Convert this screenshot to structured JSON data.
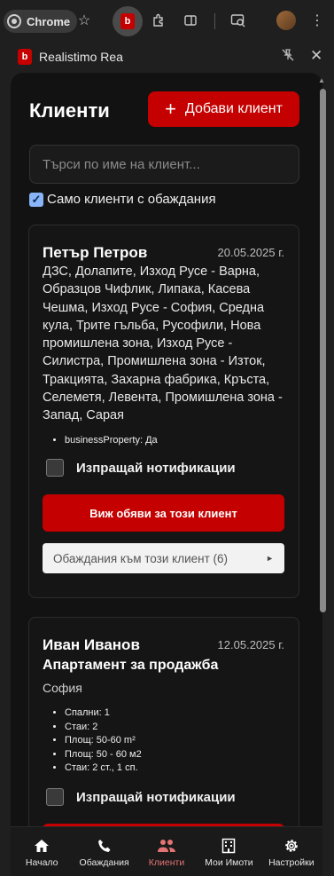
{
  "browser": {
    "chrome_label": "Chrome",
    "icons": [
      "chrome-icon",
      "star-icon",
      "extension-active-icon",
      "puzzle-icon",
      "side-panel-icon",
      "search-tab-icon",
      "avatar",
      "more-icon"
    ]
  },
  "panel": {
    "title": "Realistimo Rea",
    "logo_letter": "b"
  },
  "header": {
    "title": "Клиенти",
    "add_button_label": "Добави клиент"
  },
  "search": {
    "placeholder": "Търси по име на клиент..."
  },
  "filter": {
    "label": "Само клиенти с обаждания",
    "checked": true
  },
  "clients": [
    {
      "name": "Петър Петров",
      "date": "20.05.2025 г.",
      "areas": "ДЗС, Долапите, Изход Русе - Варна, Образцов Чифлик, Липака, Касева Чешма, Изход Русе - София, Средна кула, Трите гъльба, Русофили, Нова промишлена зона, Изход Русе - Силистра, Промишлена зона - Изток, Тракцията, Захарна фабрика, Кръста, Селеметя, Левента, Промишлена зона - Запад, Сарая",
      "props": [
        "businessProperty: Да"
      ],
      "notify_label": "Изпращай нотификации",
      "view_label": "Виж обяви за този клиент",
      "calls_label": "Обаждания към този клиент (6)"
    },
    {
      "name": "Иван Иванов",
      "date": "12.05.2025 г.",
      "type": "Апартамент за продажба",
      "city": "София",
      "props": [
        "Спални: 1",
        "Стаи: 2",
        "Площ: 50-60 m²",
        "Площ: 50 - 60 м2",
        "Стаи: 2 ст., 1 сп."
      ],
      "notify_label": "Изпращай нотификации"
    }
  ],
  "nav": {
    "items": [
      {
        "label": "Начало",
        "icon": "home-icon"
      },
      {
        "label": "Обаждания",
        "icon": "phone-icon"
      },
      {
        "label": "Клиенти",
        "icon": "people-icon",
        "active": true
      },
      {
        "label": "Мои Имоти",
        "icon": "building-icon"
      },
      {
        "label": "Настройки",
        "icon": "gear-icon"
      }
    ]
  },
  "colors": {
    "accent": "#c40000",
    "active_nav": "#e57373",
    "checkbox": "#8ab4f8"
  }
}
